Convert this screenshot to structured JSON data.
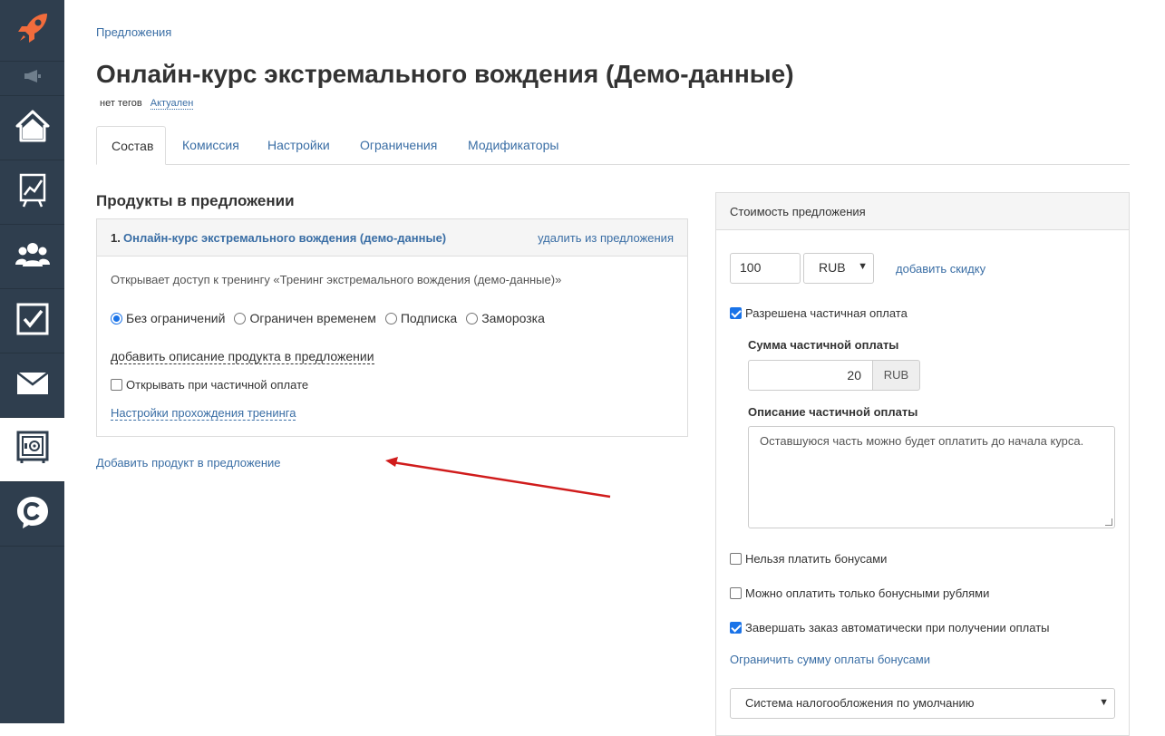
{
  "breadcrumb": "Предложения",
  "title": "Онлайн-курс экстремального вождения (Демо-данные)",
  "tags_label": "нет тегов",
  "status_label": "Актуален",
  "tabs": [
    {
      "label": "Состав"
    },
    {
      "label": "Комиссия"
    },
    {
      "label": "Настройки"
    },
    {
      "label": "Ограничения"
    },
    {
      "label": "Модификаторы"
    }
  ],
  "products_section": {
    "title": "Продукты в предложении",
    "item": {
      "number": "1.",
      "name": "Онлайн-курс экстремального вождения (демо-данные)",
      "remove_label": "удалить из предложения",
      "description": "Открывает доступ к тренингу «Тренинг экстремального вождения (демо-данные)»",
      "access_options": [
        "Без ограничений",
        "Ограничен временем",
        "Подписка",
        "Заморозка"
      ],
      "selected_access": "Без ограничений",
      "add_description_label": "добавить описание продукта в предложении",
      "open_on_partial_label": "Открывать при частичной оплате",
      "open_on_partial_checked": false,
      "training_settings_label": "Настройки прохождения тренинга"
    },
    "add_product_label": "Добавить продукт в предложение"
  },
  "price_panel": {
    "header": "Стоимость предложения",
    "price_value": "100",
    "currency": "RUB",
    "add_discount_label": "добавить скидку",
    "partial_allowed_label": "Разрешена частичная оплата",
    "partial_allowed_checked": true,
    "partial_sum_label": "Сумма частичной оплаты",
    "partial_sum_value": "20",
    "partial_sum_currency": "RUB",
    "partial_desc_label": "Описание частичной оплаты",
    "partial_desc_value": "Оставшуюся часть можно будет оплатить до начала курса.",
    "no_bonus_label": "Нельзя платить бонусами",
    "no_bonus_checked": false,
    "only_bonus_label": "Можно оплатить только бонусными рублями",
    "only_bonus_checked": false,
    "auto_complete_label": "Завершать заказ автоматически при получении оплаты",
    "auto_complete_checked": true,
    "limit_bonus_label": "Ограничить сумму оплаты бонусами",
    "tax_system": "Система налогообложения по умолчанию"
  },
  "sidebar": {
    "icons": [
      "rocket-icon",
      "megaphone-icon",
      "home-icon",
      "chart-board-icon",
      "users-icon",
      "checkbox-icon",
      "mail-icon",
      "safe-icon",
      "chat-icon"
    ],
    "active": "safe-icon"
  },
  "colors": {
    "sidebar_bg": "#2f3e4e",
    "accent_orange": "#f26c3c",
    "link_blue": "#3a6ea5",
    "annotation_red": "#d01c1c"
  }
}
